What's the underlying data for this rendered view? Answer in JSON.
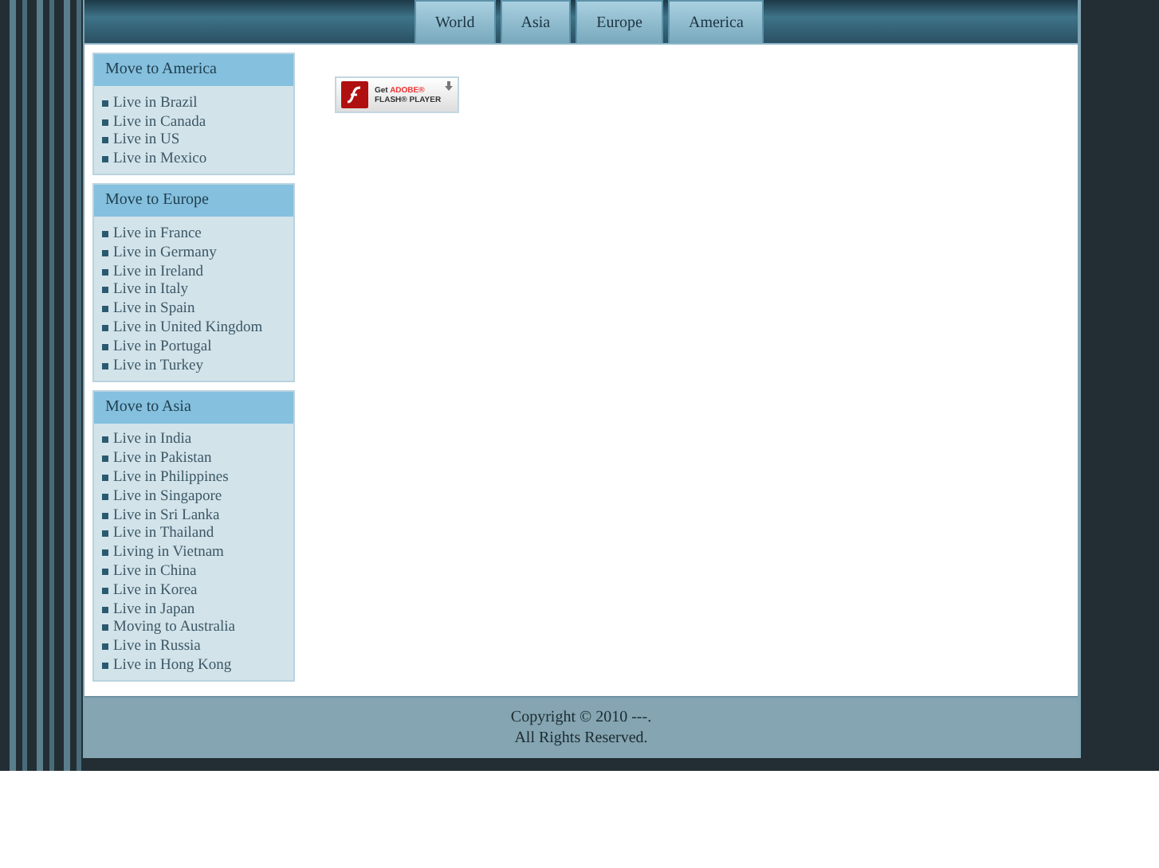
{
  "nav": {
    "tabs": [
      {
        "label": "World"
      },
      {
        "label": "Asia"
      },
      {
        "label": "Europe"
      },
      {
        "label": "America"
      }
    ]
  },
  "sidebar": {
    "sections": [
      {
        "title": "Move to America",
        "items": [
          "Live in Brazil",
          "Live in Canada",
          "Live in US",
          "Live in Mexico"
        ]
      },
      {
        "title": "Move to Europe",
        "items": [
          "Live in France",
          "Live in Germany",
          "Live in Ireland",
          "Live in Italy",
          "Live in Spain",
          "Live in United Kingdom",
          "Live in Portugal",
          "Live in Turkey"
        ]
      },
      {
        "title": "Move to Asia",
        "items": [
          "Live in India",
          "Live in Pakistan",
          "Live in Philippines",
          "Live in Singapore",
          "Live in Sri Lanka",
          "Live in Thailand",
          "Living in Vietnam",
          "Live in China",
          "Live in Korea",
          "Live in Japan",
          "Moving to Australia",
          "Live in Russia",
          "Live in Hong Kong"
        ]
      }
    ]
  },
  "flash_badge": {
    "get": "Get",
    "brand": "ADOBE®",
    "product": "FLASH® PLAYER"
  },
  "footer": {
    "lines": [
      "Copyright © 2010 ---.",
      "All Rights Reserved."
    ]
  }
}
